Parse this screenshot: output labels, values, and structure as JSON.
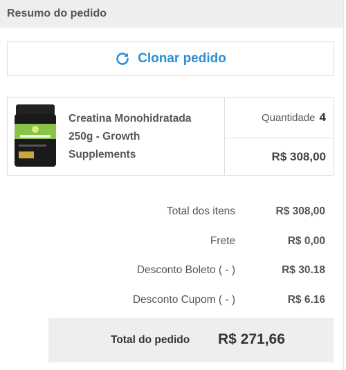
{
  "header": {
    "title": "Resumo do pedido"
  },
  "clone_button": {
    "label": "Clonar pedido",
    "icon": "refresh-icon",
    "color": "#2a8fd6"
  },
  "product": {
    "name_lines": [
      "Creatina Monohidratada",
      "250g - Growth",
      "Supplements"
    ],
    "image": "creatine-tub-image",
    "quantity_label": "Quantidade",
    "quantity": "4",
    "price": "R$ 308,00"
  },
  "summary": [
    {
      "label": "Total dos itens",
      "value": "R$ 308,00"
    },
    {
      "label": "Frete",
      "value": "R$ 0,00"
    },
    {
      "label": "Desconto Boleto ( - )",
      "value": "R$ 30.18"
    },
    {
      "label": "Desconto Cupom ( - )",
      "value": "R$ 6.16"
    }
  ],
  "total": {
    "label": "Total do pedido",
    "value": "R$ 271,66"
  }
}
